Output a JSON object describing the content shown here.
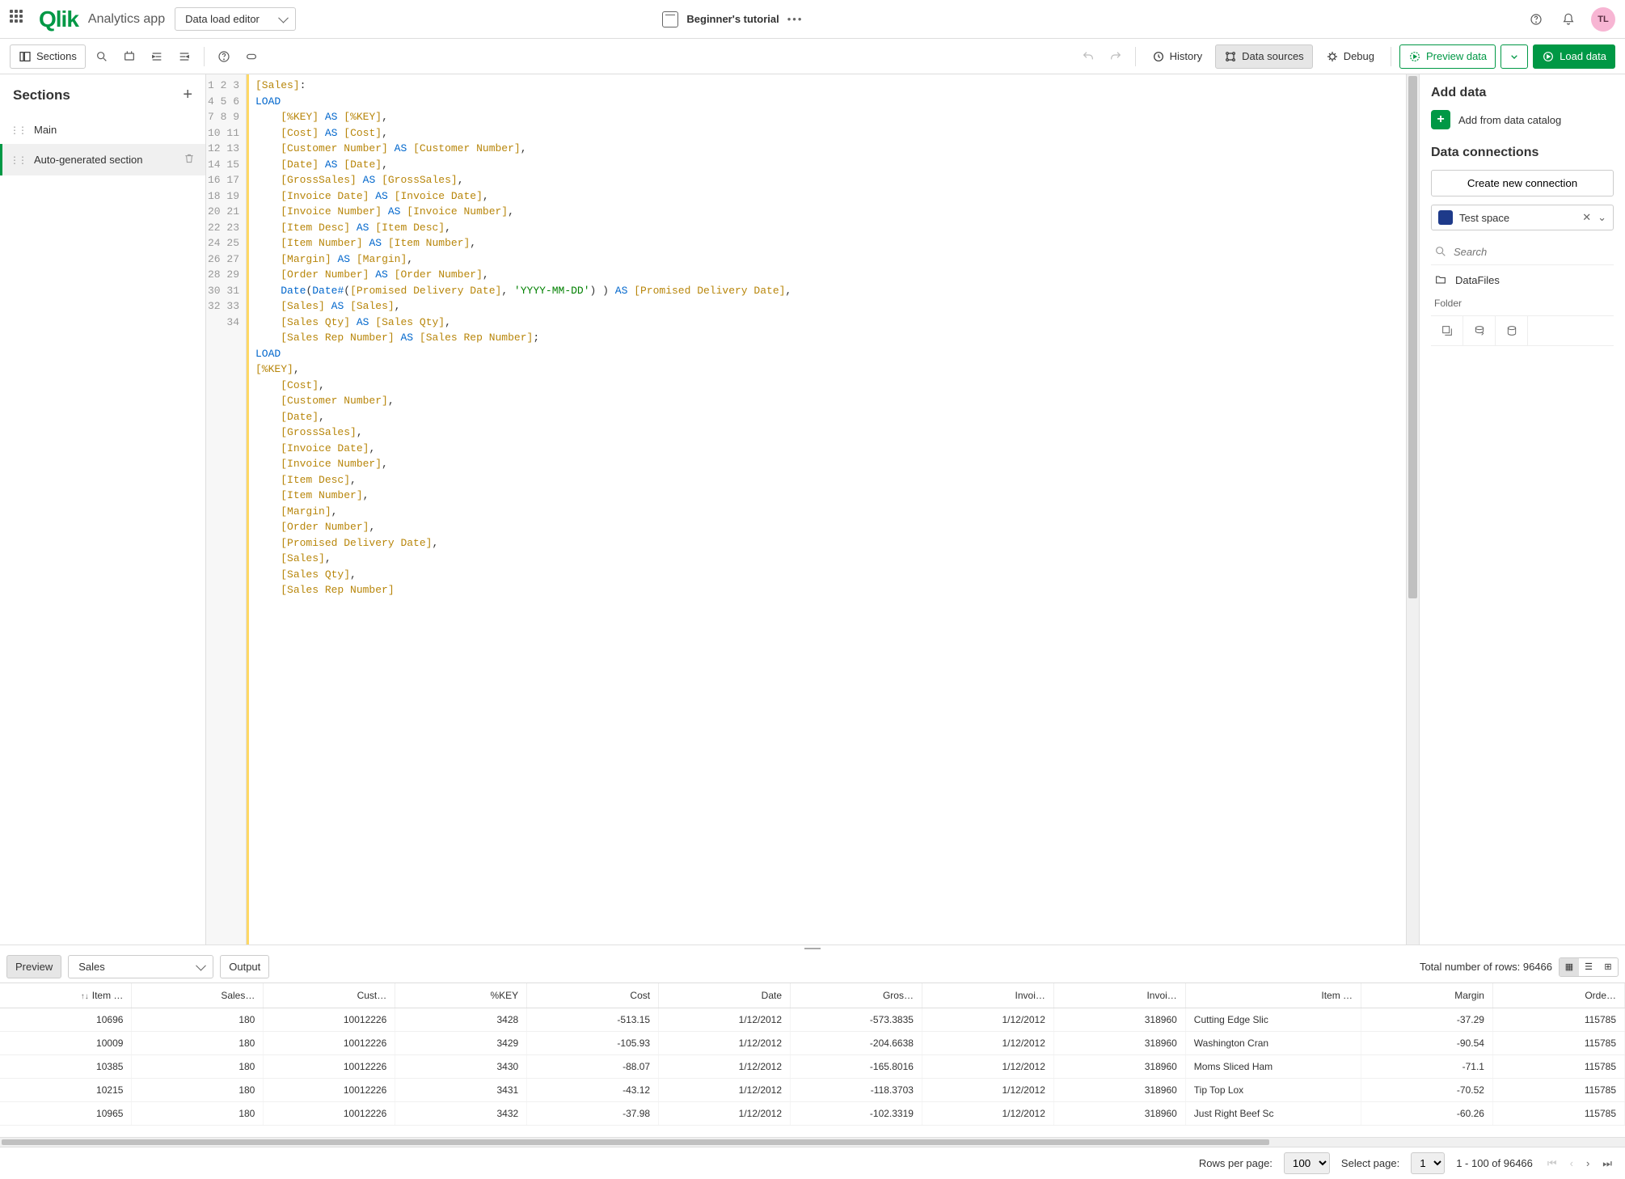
{
  "topbar": {
    "logo": "Qlik",
    "app_name": "Analytics app",
    "mode": "Data load editor",
    "doc_title": "Beginner's tutorial",
    "avatar": "TL"
  },
  "toolbar": {
    "sections": "Sections",
    "history": "History",
    "data_sources": "Data sources",
    "debug": "Debug",
    "preview": "Preview data",
    "load": "Load data"
  },
  "sidebar": {
    "title": "Sections",
    "items": [
      "Main",
      "Auto-generated section"
    ]
  },
  "code": {
    "lines": [
      {
        "n": 1,
        "h": "<span class='br'>[Sales]</span>:"
      },
      {
        "n": 2,
        "h": "<span class='kw'>LOAD</span>"
      },
      {
        "n": 3,
        "h": "    <span class='br'>[%KEY]</span> <span class='kw'>AS</span> <span class='br'>[%KEY]</span>,"
      },
      {
        "n": 4,
        "h": "    <span class='br'>[Cost]</span> <span class='kw'>AS</span> <span class='br'>[Cost]</span>,"
      },
      {
        "n": 5,
        "h": "    <span class='br'>[Customer Number]</span> <span class='kw'>AS</span> <span class='br'>[Customer Number]</span>,"
      },
      {
        "n": 6,
        "h": "    <span class='br'>[Date]</span> <span class='kw'>AS</span> <span class='br'>[Date]</span>,"
      },
      {
        "n": 7,
        "h": "    <span class='br'>[GrossSales]</span> <span class='kw'>AS</span> <span class='br'>[GrossSales]</span>,"
      },
      {
        "n": 8,
        "h": "    <span class='br'>[Invoice Date]</span> <span class='kw'>AS</span> <span class='br'>[Invoice Date]</span>,"
      },
      {
        "n": 9,
        "h": "    <span class='br'>[Invoice Number]</span> <span class='kw'>AS</span> <span class='br'>[Invoice Number]</span>,"
      },
      {
        "n": 10,
        "h": "    <span class='br'>[Item Desc]</span> <span class='kw'>AS</span> <span class='br'>[Item Desc]</span>,"
      },
      {
        "n": 11,
        "h": "    <span class='br'>[Item Number]</span> <span class='kw'>AS</span> <span class='br'>[Item Number]</span>,"
      },
      {
        "n": 12,
        "h": "    <span class='br'>[Margin]</span> <span class='kw'>AS</span> <span class='br'>[Margin]</span>,"
      },
      {
        "n": 13,
        "h": "    <span class='br'>[Order Number]</span> <span class='kw'>AS</span> <span class='br'>[Order Number]</span>,"
      },
      {
        "n": 14,
        "h": "    <span class='fn'>Date</span>(<span class='fn'>Date#</span>(<span class='br'>[Promised Delivery Date]</span>, <span class='str'>'YYYY-MM-DD'</span>) ) <span class='kw'>AS</span> <span class='br'>[Promised Delivery Date]</span>,"
      },
      {
        "n": 15,
        "h": "    <span class='br'>[Sales]</span> <span class='kw'>AS</span> <span class='br'>[Sales]</span>,"
      },
      {
        "n": 16,
        "h": "    <span class='br'>[Sales Qty]</span> <span class='kw'>AS</span> <span class='br'>[Sales Qty]</span>,"
      },
      {
        "n": 17,
        "h": "    <span class='br'>[Sales Rep Number]</span> <span class='kw'>AS</span> <span class='br'>[Sales Rep Number]</span>;"
      },
      {
        "n": 18,
        "h": "<span class='kw'>LOAD</span>"
      },
      {
        "n": 19,
        "h": "<span class='br'>[%KEY]</span>,"
      },
      {
        "n": 20,
        "h": "    <span class='br'>[Cost]</span>,"
      },
      {
        "n": 21,
        "h": "    <span class='br'>[Customer Number]</span>,"
      },
      {
        "n": 22,
        "h": "    <span class='br'>[Date]</span>,"
      },
      {
        "n": 23,
        "h": "    <span class='br'>[GrossSales]</span>,"
      },
      {
        "n": 24,
        "h": "    <span class='br'>[Invoice Date]</span>,"
      },
      {
        "n": 25,
        "h": "    <span class='br'>[Invoice Number]</span>,"
      },
      {
        "n": 26,
        "h": "    <span class='br'>[Item Desc]</span>,"
      },
      {
        "n": 27,
        "h": "    <span class='br'>[Item Number]</span>,"
      },
      {
        "n": 28,
        "h": "    <span class='br'>[Margin]</span>,"
      },
      {
        "n": 29,
        "h": "    <span class='br'>[Order Number]</span>,"
      },
      {
        "n": 30,
        "h": "    <span class='br'>[Promised Delivery Date]</span>,"
      },
      {
        "n": 31,
        "h": "    <span class='br'>[Sales]</span>,"
      },
      {
        "n": 32,
        "h": "    <span class='br'>[Sales Qty]</span>,"
      },
      {
        "n": 33,
        "h": "    <span class='br'>[Sales Rep Number]</span>"
      },
      {
        "n": 34,
        "h": ""
      }
    ]
  },
  "right": {
    "add_data": "Add data",
    "add_catalog": "Add from data catalog",
    "connections": "Data connections",
    "create_conn": "Create new connection",
    "space": "Test space",
    "search_ph": "Search",
    "folder_item": "DataFiles",
    "folder_label": "Folder"
  },
  "preview": {
    "preview_btn": "Preview",
    "table_select": "Sales",
    "output_btn": "Output",
    "total_rows_label": "Total number of rows: ",
    "total_rows": "96466",
    "columns": [
      "Item …",
      "Sales…",
      "Cust…",
      "%KEY",
      "Cost",
      "Date",
      "Gros…",
      "Invoi…",
      "Invoi…",
      "Item …",
      "Margin",
      "Orde…"
    ],
    "rows": [
      [
        "10696",
        "180",
        "10012226",
        "3428",
        "-513.15",
        "1/12/2012",
        "-573.3835",
        "1/12/2012",
        "318960",
        "Cutting Edge Slic",
        "-37.29",
        "115785"
      ],
      [
        "10009",
        "180",
        "10012226",
        "3429",
        "-105.93",
        "1/12/2012",
        "-204.6638",
        "1/12/2012",
        "318960",
        "Washington Cran",
        "-90.54",
        "115785"
      ],
      [
        "10385",
        "180",
        "10012226",
        "3430",
        "-88.07",
        "1/12/2012",
        "-165.8016",
        "1/12/2012",
        "318960",
        "Moms Sliced Ham",
        "-71.1",
        "115785"
      ],
      [
        "10215",
        "180",
        "10012226",
        "3431",
        "-43.12",
        "1/12/2012",
        "-118.3703",
        "1/12/2012",
        "318960",
        "Tip Top Lox",
        "-70.52",
        "115785"
      ],
      [
        "10965",
        "180",
        "10012226",
        "3432",
        "-37.98",
        "1/12/2012",
        "-102.3319",
        "1/12/2012",
        "318960",
        "Just Right Beef Sc",
        "-60.26",
        "115785"
      ]
    ]
  },
  "pager": {
    "rows_label": "Rows per page:",
    "rows_value": "100",
    "page_label": "Select page:",
    "page_value": "1",
    "range": "1 - 100 of 96466"
  }
}
